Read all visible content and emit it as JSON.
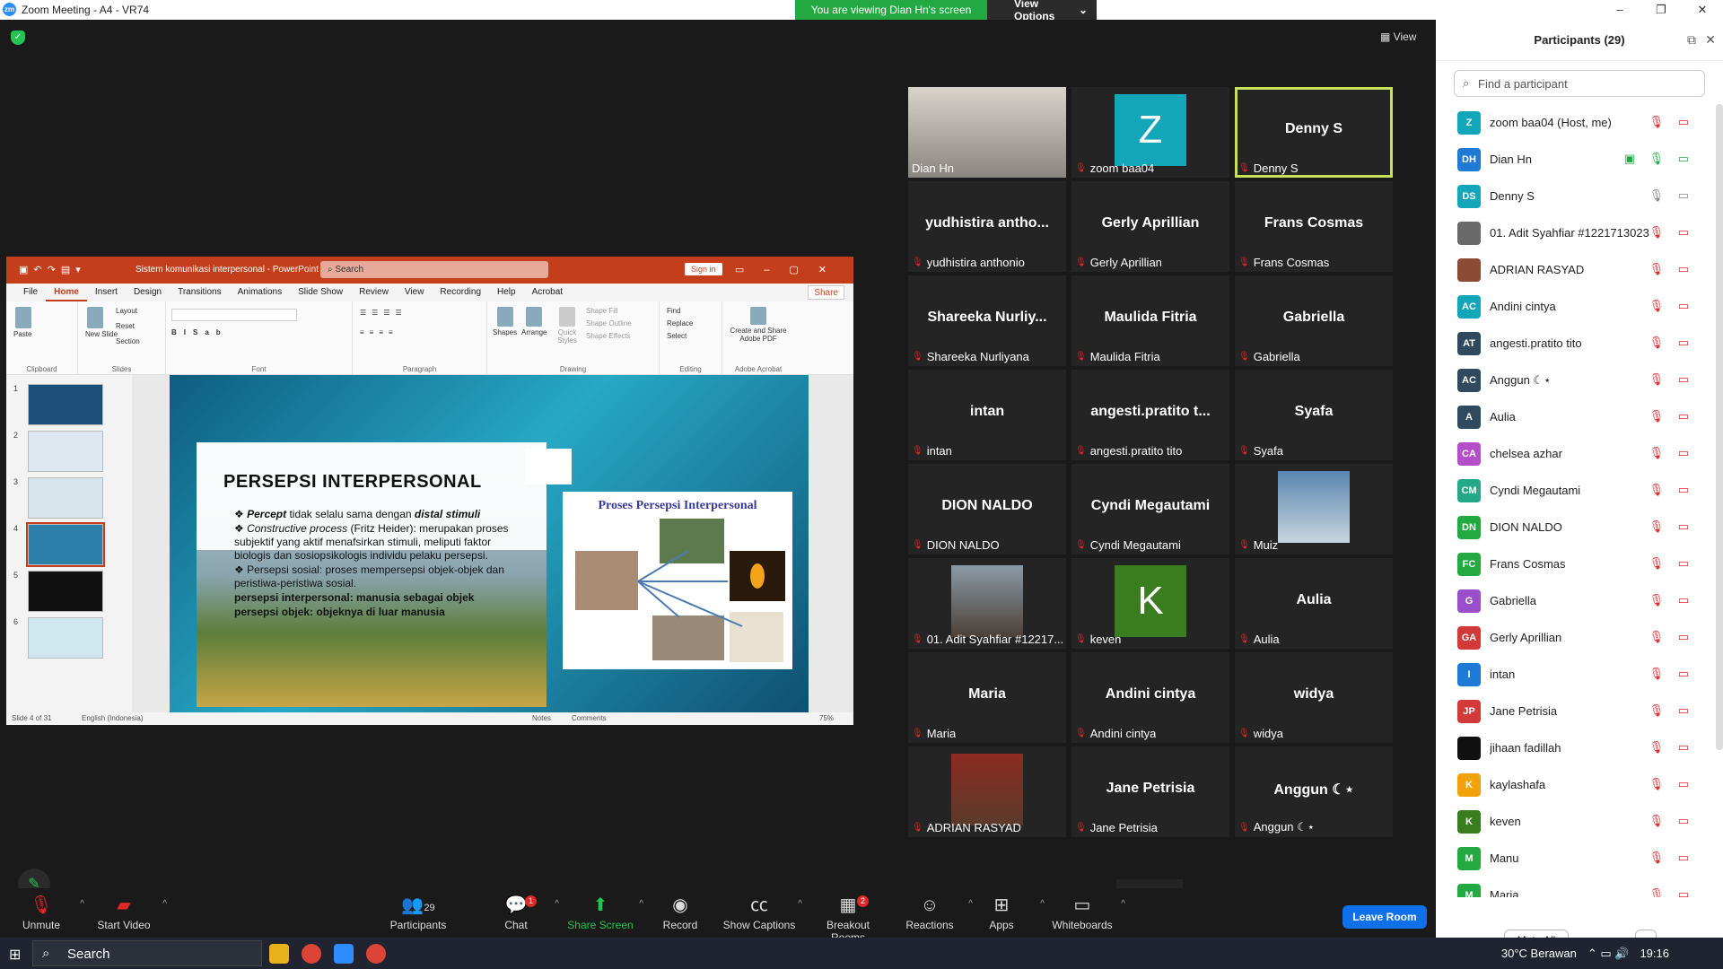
{
  "window": {
    "title": "Zoom Meeting - A4 - VR74",
    "logo": "zm",
    "min": "–",
    "max": "❐",
    "close": "✕"
  },
  "banner": {
    "viewing": "You are viewing Dian Hn's screen",
    "options": "View Options"
  },
  "view_label": "View",
  "ppt": {
    "doc_title": "Sistem komunikasi interpersonal  -  PowerPoint",
    "search": "Search",
    "signin": "Sign in",
    "tabs": [
      "File",
      "Home",
      "Insert",
      "Design",
      "Transitions",
      "Animations",
      "Slide Show",
      "Review",
      "View",
      "Recording",
      "Help",
      "Acrobat"
    ],
    "share": "Share",
    "groups": {
      "clipboard": "Clipboard",
      "slides": "Slides",
      "font": "Font",
      "paragraph": "Paragraph",
      "drawing": "Drawing",
      "editing": "Editing",
      "adobe": "Adobe Acrobat"
    },
    "ribbon": {
      "paste": "Paste",
      "new_slide": "New Slide",
      "layout": "Layout",
      "reset": "Reset",
      "section": "Section",
      "shapes": "Shapes",
      "arrange": "Arrange",
      "quick_styles": "Quick Styles",
      "shape_fill": "Shape Fill",
      "shape_outline": "Shape Outline",
      "shape_effects": "Shape Effects",
      "find": "Find",
      "replace": "Replace",
      "select": "Select",
      "create_share": "Create and Share Adobe PDF"
    },
    "thumbs": [
      "1",
      "2",
      "3",
      "4",
      "5",
      "6"
    ],
    "slide": {
      "title": "PERSEPSI INTERPERSONAL",
      "b1a": "Percept",
      "b1b": " tidak selalu sama dengan ",
      "b1c": "distal stimuli",
      "b2a": "Constructive process",
      "b2b": " (Fritz Heider): merupakan proses subjektif yang aktif menafsirkan stimuli, meliputi faktor biologis dan sosiopsikologis individu pelaku persepsi.",
      "b3": "Persepsi sosial: proses mempersepsi objek-objek dan peristiwa-peristiwa sosial.",
      "b4": "persepsi interpersonal: manusia sebagai objek",
      "b5": "persepsi objek: objeknya di luar manusia",
      "diagram_title": "Proses Persepsi Interpersonal"
    },
    "status": {
      "slide": "Slide 4 of 31",
      "lang": "English (Indonesia)",
      "notes": "Notes",
      "comments": "Comments",
      "zoom": "75%"
    }
  },
  "tiles": [
    {
      "big": "",
      "label": "Dian Hn",
      "type": "video"
    },
    {
      "big": "Z",
      "label": "zoom baa04",
      "type": "avatar",
      "color": "#13a5b8"
    },
    {
      "big": "Denny S",
      "label": "Denny S",
      "type": "name",
      "speaking": true
    },
    {
      "big": "yudhistira antho...",
      "label": "yudhistira anthonio"
    },
    {
      "big": "Gerly Aprillian",
      "label": "Gerly Aprillian"
    },
    {
      "big": "Frans Cosmas",
      "label": "Frans Cosmas"
    },
    {
      "big": "Shareeka Nurliy...",
      "label": "Shareeka Nurliyana"
    },
    {
      "big": "Maulida Fitria",
      "label": "Maulida Fitria"
    },
    {
      "big": "Gabriella",
      "label": "Gabriella"
    },
    {
      "big": "intan",
      "label": "intan"
    },
    {
      "big": "angesti.pratito t...",
      "label": "angesti.pratito tito"
    },
    {
      "big": "Syafa",
      "label": "Syafa"
    },
    {
      "big": "DION NALDO",
      "label": "DION NALDO"
    },
    {
      "big": "Cyndi Megautami",
      "label": "Cyndi Megautami"
    },
    {
      "big": "",
      "label": "Muiz",
      "type": "photo",
      "c1": "#5a86b0",
      "c2": "#c7d4df"
    },
    {
      "big": "",
      "label": "01. Adit Syahfiar #12217...",
      "type": "photo",
      "c1": "#8b9aa6",
      "c2": "#4c4038"
    },
    {
      "big": "K",
      "label": "keven",
      "type": "avatar",
      "color": "#3a7d1e"
    },
    {
      "big": "Aulia",
      "label": "Aulia"
    },
    {
      "big": "Maria",
      "label": "Maria"
    },
    {
      "big": "Andini cintya",
      "label": "Andini cintya"
    },
    {
      "big": "widya",
      "label": "widya"
    },
    {
      "big": "",
      "label": "ADRIAN RASYAD",
      "type": "photo",
      "c1": "#8c2b22",
      "c2": "#5a3a2a"
    },
    {
      "big": "Jane Petrisia",
      "label": "Jane Petrisia"
    },
    {
      "big": "Anggun ☾⋆",
      "label": "Anggun ☾⋆"
    }
  ],
  "participants": {
    "title": "Participants (29)",
    "find": "Find a participant",
    "list": [
      {
        "init": "Z",
        "name": "zoom baa04 (Host, me)",
        "color": "#13a5b8"
      },
      {
        "init": "DH",
        "name": "Dian Hn",
        "color": "#1f7ad6",
        "sharing": true
      },
      {
        "init": "DS",
        "name": "Denny S",
        "color": "#13a5b8",
        "unmuted": true
      },
      {
        "init": "",
        "name": "01. Adit Syahfiar #1221713023",
        "color": "#6a6a6a"
      },
      {
        "init": "",
        "name": "ADRIAN RASYAD",
        "color": "#8c4b34"
      },
      {
        "init": "AC",
        "name": "Andini cintya",
        "color": "#13a5b8"
      },
      {
        "init": "AT",
        "name": "angesti.pratito tito",
        "color": "#2f4a5e"
      },
      {
        "init": "AC",
        "name": "Anggun ☾⋆",
        "color": "#2f4a5e"
      },
      {
        "init": "A",
        "name": "Aulia",
        "color": "#2f4a5e"
      },
      {
        "init": "CA",
        "name": "chelsea azhar",
        "color": "#b54ec9"
      },
      {
        "init": "CM",
        "name": "Cyndi Megautami",
        "color": "#23a988"
      },
      {
        "init": "DN",
        "name": "DION NALDO",
        "color": "#23a942"
      },
      {
        "init": "FC",
        "name": "Frans Cosmas",
        "color": "#23a942"
      },
      {
        "init": "G",
        "name": "Gabriella",
        "color": "#9b4ec9"
      },
      {
        "init": "GA",
        "name": "Gerly Aprillian",
        "color": "#d23a3a"
      },
      {
        "init": "I",
        "name": "intan",
        "color": "#1f7ad6"
      },
      {
        "init": "JP",
        "name": "Jane Petrisia",
        "color": "#d23a3a"
      },
      {
        "init": "",
        "name": "jihaan fadillah",
        "color": "#111"
      },
      {
        "init": "K",
        "name": "kaylashafa",
        "color": "#f2a20c"
      },
      {
        "init": "K",
        "name": "keven",
        "color": "#3a7d1e"
      },
      {
        "init": "M",
        "name": "Manu",
        "color": "#23a942"
      },
      {
        "init": "M",
        "name": "Maria",
        "color": "#23a942"
      }
    ],
    "mute_all": "Mute All",
    "more": "···"
  },
  "toolbar": {
    "unmute": "Unmute",
    "start_video": "Start Video",
    "participants": "Participants",
    "participants_count": "29",
    "chat": "Chat",
    "chat_badge": "1",
    "share": "Share Screen",
    "record": "Record",
    "captions": "Show Captions",
    "breakout": "Breakout Rooms",
    "breakout_badge": "2",
    "reactions": "Reactions",
    "apps": "Apps",
    "whiteboards": "Whiteboards",
    "leave": "Leave Room"
  },
  "taskbar": {
    "search": "Search",
    "weather": "30°C  Berawan",
    "time": "19:16"
  }
}
